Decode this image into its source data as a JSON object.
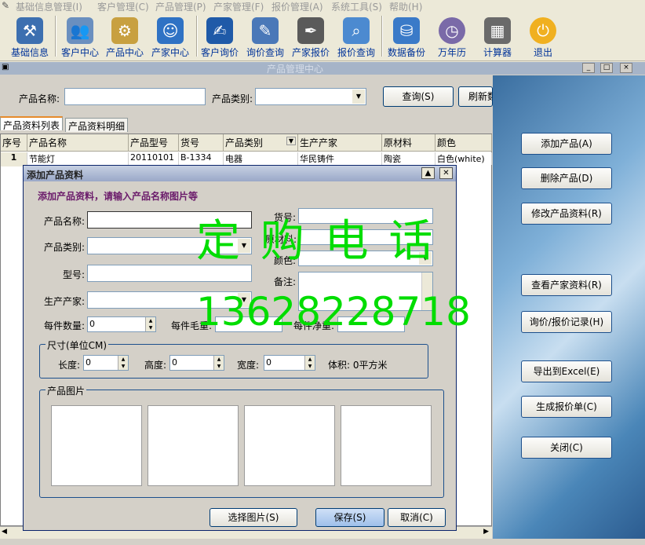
{
  "menu": [
    "基础信息管理(I)",
    "客户管理(C)",
    "产品管理(P)",
    "产家管理(F)",
    "报价管理(A)",
    "系统工具(S)",
    "帮助(H)"
  ],
  "toolbar": [
    {
      "label": "基础信息",
      "icon": "tools-icon",
      "color": "#3c6fb0"
    },
    {
      "label": "客户中心",
      "icon": "users-icon",
      "color": "#6a8fbf"
    },
    {
      "label": "产品中心",
      "icon": "network-icon",
      "color": "#c8a040"
    },
    {
      "label": "产家中心",
      "icon": "people-icon",
      "color": "#2f72c4"
    },
    {
      "label": "客户询价",
      "icon": "globe-pen-icon",
      "color": "#1f5aa8"
    },
    {
      "label": "询价查询",
      "icon": "pen-paper-icon",
      "color": "#4a78b8"
    },
    {
      "label": "产家报价",
      "icon": "fountain-pen-icon",
      "color": "#5a5a5a"
    },
    {
      "label": "报价查询",
      "icon": "magnifier-icon",
      "color": "#4c8ad0"
    },
    {
      "label": "数据备份",
      "icon": "database-icon",
      "color": "#3a7ac8"
    },
    {
      "label": "万年历",
      "icon": "clock-icon",
      "color": "#7a6aa8"
    },
    {
      "label": "计算器",
      "icon": "calculator-icon",
      "color": "#6a6a6a"
    },
    {
      "label": "退出",
      "icon": "power-icon",
      "color": "#f0b020"
    }
  ],
  "window": {
    "title": "产品管理中心"
  },
  "search": {
    "name_label": "产品名称:",
    "name_value": "",
    "type_label": "产品类别:",
    "type_value": "",
    "query_button": "查询(S)",
    "refresh_button": "刷新数"
  },
  "tabs": [
    "产品资料列表",
    "产品资料明细"
  ],
  "grid": {
    "headers": [
      "序号",
      "产品名称",
      "产品型号",
      "货号",
      "产品类别",
      "生产产家",
      "原材料",
      "颜色"
    ],
    "rows": [
      [
        "1",
        "节能灯",
        "20110101",
        "B-1334",
        "电器",
        "华民铸件",
        "陶瓷",
        "白色(white)"
      ]
    ]
  },
  "right_panel": {
    "buttons": [
      "添加产品(A)",
      "删除产品(D)",
      "修改产品资料(R)",
      "查看产家资料(R)",
      "询价/报价记录(H)",
      "导出到Excel(E)",
      "生成报价单(C)",
      "关闭(C)"
    ]
  },
  "dialog": {
    "title": "添加产品资料",
    "hint": "添加产品资料，请输入产品名称图片等",
    "labels": {
      "name": "产品名称:",
      "type": "产品类别:",
      "model": "型号:",
      "maker": "生产产家:",
      "item_no": "货号:",
      "material": "原材料:",
      "color": "颜色:",
      "remark": "备注:",
      "qty": "每件数量:",
      "gross": "每件毛重:",
      "net": "每件净重:"
    },
    "values": {
      "qty": "0",
      "length": "0",
      "height": "0",
      "width": "0"
    },
    "size_group": {
      "title": "尺寸(单位CM)",
      "length_label": "长度:",
      "height_label": "高度:",
      "width_label": "宽度:",
      "volume": "体积: 0平方米"
    },
    "picture_group": {
      "title": "产品图片"
    },
    "buttons": {
      "select_pic": "选择图片(S)",
      "save": "保存(S)",
      "cancel": "取消(C)"
    }
  },
  "watermark": {
    "line1": "定 购 电 话",
    "line2": "13628228718",
    "color": "#00dd00"
  }
}
